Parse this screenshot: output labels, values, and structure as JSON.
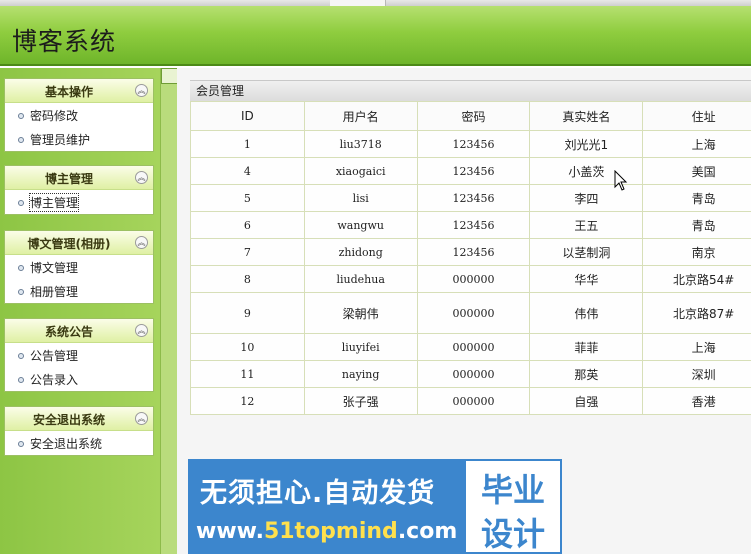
{
  "app": {
    "title": "博客系统"
  },
  "sidebar": {
    "groups": [
      {
        "title": "基本操作",
        "items": [
          "密码修改",
          "管理员维护"
        ]
      },
      {
        "title": "博主管理",
        "items": [
          "博主管理"
        ]
      },
      {
        "title": "博文管理(相册)",
        "items": [
          "博文管理",
          "相册管理"
        ]
      },
      {
        "title": "系统公告",
        "items": [
          "公告管理",
          "公告录入"
        ]
      },
      {
        "title": "安全退出系统",
        "items": [
          "安全退出系统"
        ]
      }
    ],
    "toggle_icon": "chevron-double-up-icon"
  },
  "main": {
    "panel_title": "会员管理",
    "table": {
      "headers": [
        "ID",
        "用户名",
        "密码",
        "真实姓名",
        "住址"
      ],
      "rows": [
        [
          "1",
          "liu3718",
          "123456",
          "刘光光1",
          "上海"
        ],
        [
          "4",
          "xiaogaici",
          "123456",
          "小盖茨",
          "美国"
        ],
        [
          "5",
          "lisi",
          "123456",
          "李四",
          "青岛"
        ],
        [
          "6",
          "wangwu",
          "123456",
          "王五",
          "青岛"
        ],
        [
          "7",
          "zhidong",
          "123456",
          "以茎制洞",
          "南京"
        ],
        [
          "8",
          "liudehua",
          "000000",
          "华华",
          "北京路54#"
        ],
        [
          "9",
          "梁朝伟",
          "000000",
          "伟伟",
          "北京路87#"
        ],
        [
          "10",
          "liuyifei",
          "000000",
          "菲菲",
          "上海"
        ],
        [
          "11",
          "naying",
          "000000",
          "那英",
          "深圳"
        ],
        [
          "12",
          "张子强",
          "000000",
          "自强",
          "香港"
        ]
      ]
    }
  },
  "banner": {
    "slogan": "无须担心.自动发货",
    "url_prefix": "www.",
    "url_accent": "51topmind",
    "url_suffix": ".com",
    "badge_line1": "毕业",
    "badge_line2": "设计"
  },
  "colors": {
    "header_green": "#8fcd3f",
    "sidebar_green": "#a6d45c",
    "banner_blue": "#3c86cd"
  }
}
